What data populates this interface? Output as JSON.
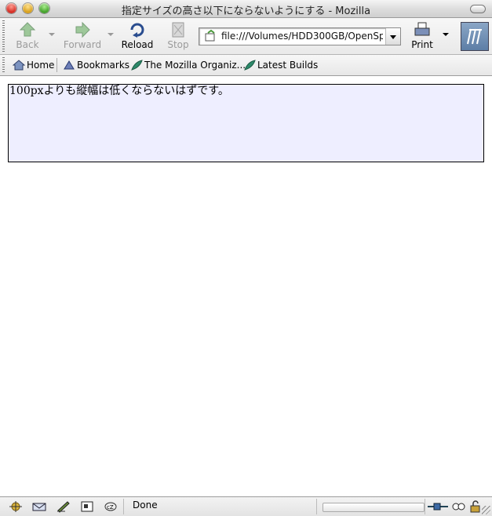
{
  "window": {
    "title": "指定サイズの高さ以下にならないようにする - Mozilla"
  },
  "navbar": {
    "back_label": "Back",
    "forward_label": "Forward",
    "reload_label": "Reload",
    "stop_label": "Stop",
    "url": "file:///Volumes/HDD300GB/OpenSpac",
    "print_label": "Print",
    "logo_icon": "mozilla-logo-icon"
  },
  "personal_toolbar": {
    "items": [
      {
        "label": "Home",
        "icon": "home-icon"
      },
      {
        "label": "Bookmarks",
        "icon": "bookmarks-icon"
      },
      {
        "label": "The Mozilla Organiz...",
        "icon": "bookmark-leaf-icon"
      },
      {
        "label": "Latest Builds",
        "icon": "bookmark-leaf-icon"
      }
    ]
  },
  "content": {
    "box_text": "100pxよりも縦幅は低くならないはずです。",
    "box_background": "#eeeeff"
  },
  "status": {
    "text": "Done",
    "icons": [
      "navigator-icon",
      "mail-icon",
      "composer-icon",
      "address-book-icon",
      "irc-chat-icon",
      "offline-online-icon",
      "security-lock-icon"
    ]
  }
}
